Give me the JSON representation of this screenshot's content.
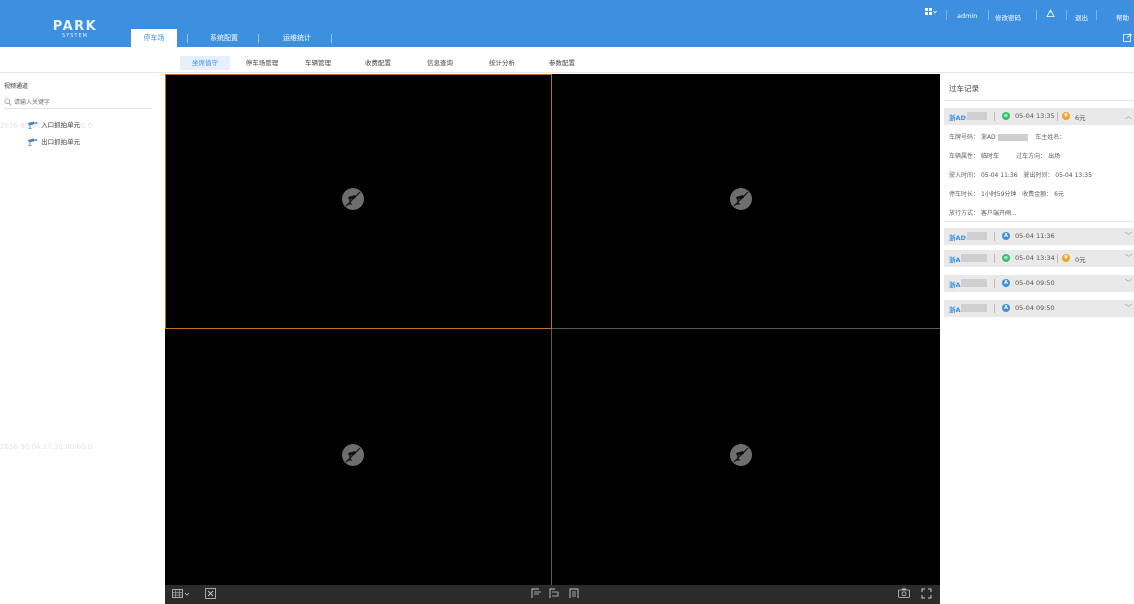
{
  "app": {
    "logo_line1": "PARK",
    "logo_line2": "SYSTEM",
    "nav_tabs": [
      {
        "label": "停车场",
        "active": true
      },
      {
        "label": "系统配置",
        "active": false
      },
      {
        "label": "运维统计",
        "active": false
      }
    ],
    "user": {
      "username": "admin",
      "change_password": "修改密码",
      "logout": "退出",
      "help": "帮助"
    }
  },
  "sub_nav": [
    {
      "label": "坐席值守",
      "active": true
    },
    {
      "label": "停车场管理",
      "active": false
    },
    {
      "label": "车辆管理",
      "active": false
    },
    {
      "label": "收费配置",
      "active": false
    },
    {
      "label": "信息查询",
      "active": false
    },
    {
      "label": "统计分析",
      "active": false
    },
    {
      "label": "参数配置",
      "active": false
    }
  ],
  "left_panel": {
    "title": "视频通道",
    "search_placeholder": "请输入关键字",
    "tree": [
      {
        "label": "入口抓拍单元"
      },
      {
        "label": "出口抓拍单元"
      }
    ],
    "ghost_text_top": "2036-90:04:17,36:00:00:0",
    "ghost_text_mid": "2036-90:04:17,36:00:00:0"
  },
  "video": {
    "tiles": 4,
    "selected_tile": 0
  },
  "records": {
    "title": "过车记录",
    "items": [
      {
        "plate": "浙AD",
        "direction": "exit",
        "time": "05-04 13:35",
        "fee": "6元",
        "expanded": true,
        "details": {
          "plate_label": "车牌号码：",
          "plate_value": "浙AD",
          "owner_label": "车主姓名：",
          "owner_value": "",
          "attr_label": "车辆属性：",
          "attr_value": "临时车",
          "dir_label": "过车方向：",
          "dir_value": "出场",
          "in_label": "驶入时间：",
          "in_value": "05-04 11:36",
          "out_label": "驶出时间：",
          "out_value": "05-04 13:35",
          "dur_label": "停车时长：",
          "dur_value": "1小时59分钟",
          "fee_label": "收费金额：",
          "fee_value": "6元",
          "release_label": "放行方式：",
          "release_value": "客户端开闸..."
        }
      },
      {
        "plate": "浙AD",
        "direction": "entry",
        "time": "05-04 11:36",
        "fee": "",
        "expanded": false
      },
      {
        "plate": "浙A",
        "direction": "exit",
        "time": "05-04 13:34",
        "fee": "0元",
        "expanded": false
      },
      {
        "plate": "浙A",
        "direction": "entry",
        "time": "05-04 09:50",
        "fee": "",
        "expanded": false
      },
      {
        "plate": "浙A",
        "direction": "entry",
        "time": "05-04 09:50",
        "fee": "",
        "expanded": false
      }
    ]
  },
  "colors": {
    "brand_blue": "#3d8fdf",
    "exit_green": "#35c26b",
    "entry_blue": "#3d8fdf",
    "fee_orange": "#f0a42a",
    "selected_tile_border": "#c36f22"
  }
}
